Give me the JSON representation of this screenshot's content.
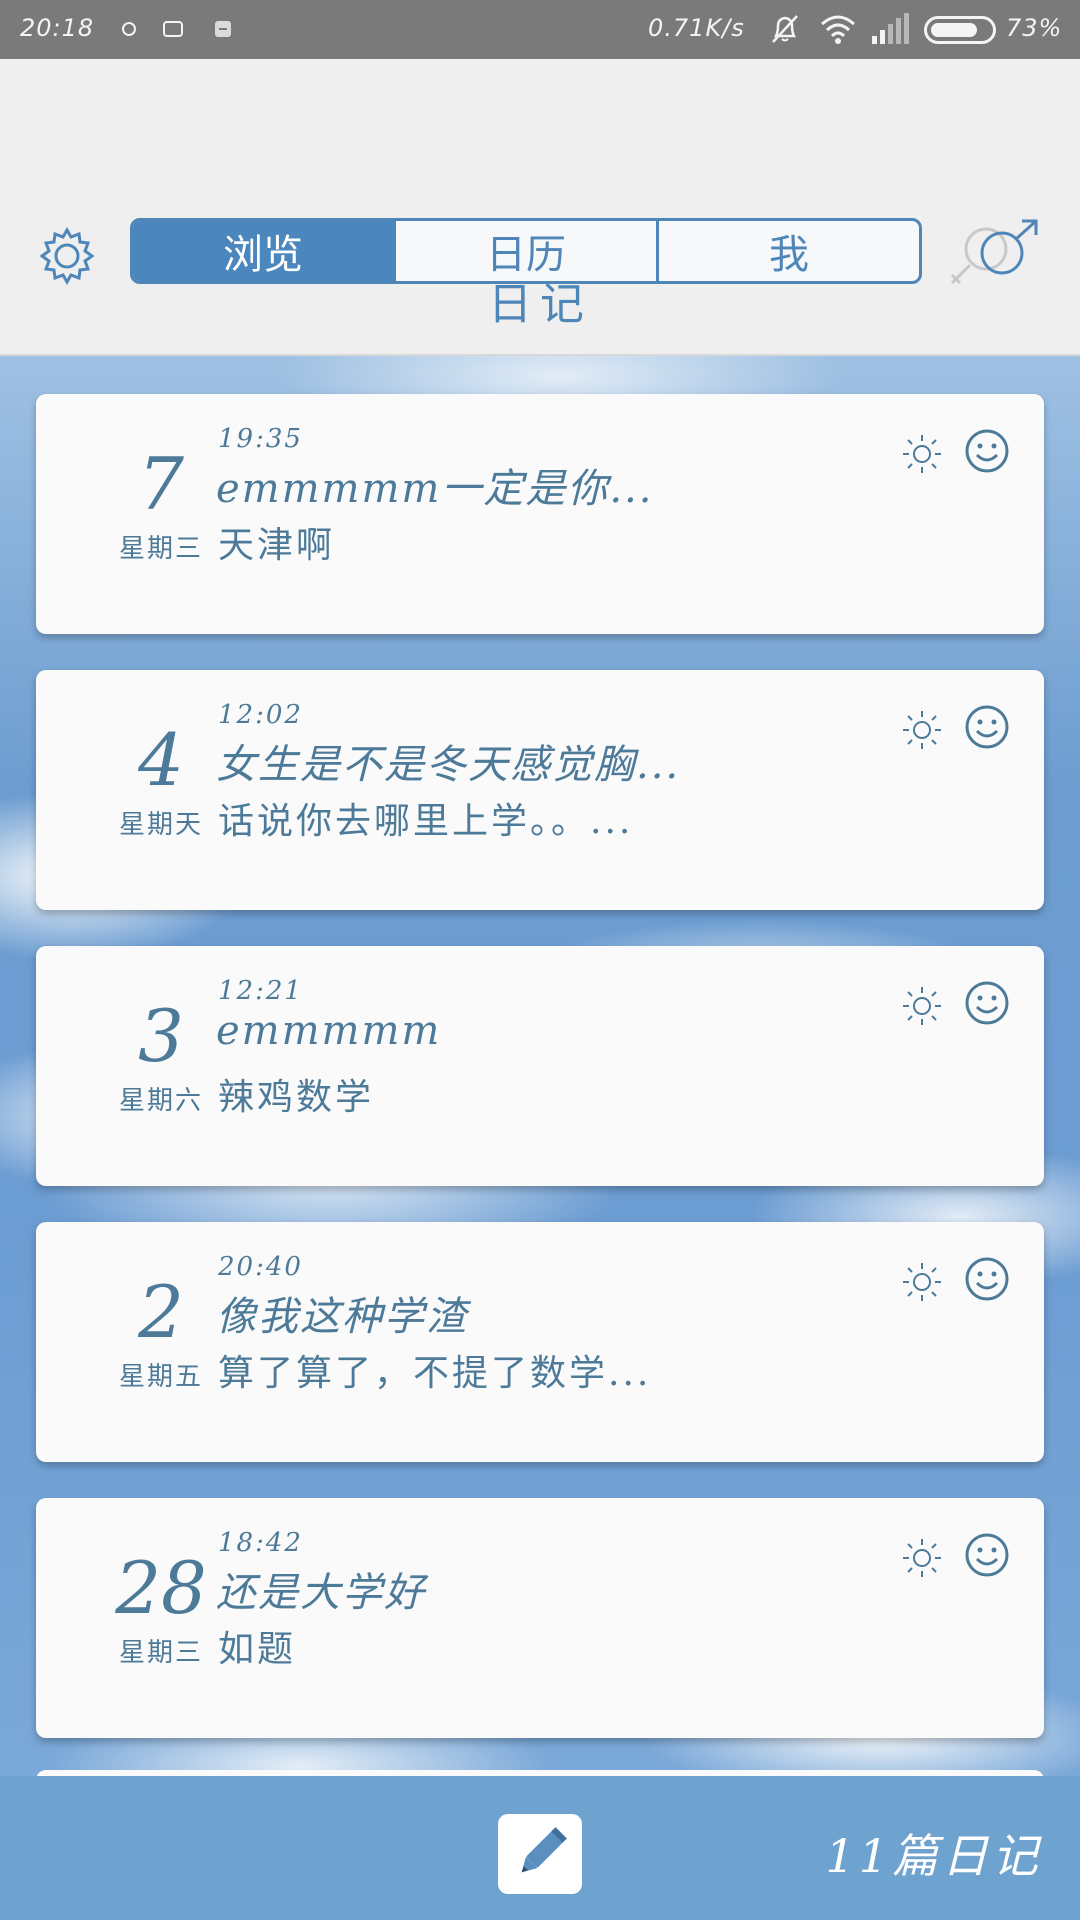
{
  "status_bar": {
    "time": "20:18",
    "net_speed": "0.71K/s",
    "battery_pct": "73%",
    "battery_level": 0.73,
    "icons": [
      "circle-notification-icon",
      "hd-icon",
      "message-icon",
      "mute-icon",
      "wifi-icon",
      "signal-icon",
      "battery-icon"
    ]
  },
  "header": {
    "tabs": [
      {
        "label": "浏览",
        "active": true
      },
      {
        "label": "日历",
        "active": false
      },
      {
        "label": "我",
        "active": false
      }
    ],
    "title": "日记",
    "icons": {
      "settings": "gear-icon",
      "gender": "gender-icon"
    },
    "accent": "#4b86bd"
  },
  "entries": [
    {
      "day": "7",
      "weekday": "星期三",
      "time": "19:35",
      "title": "emmmmm一定是你...",
      "body": "天津啊",
      "weather": "sun-icon",
      "mood": "smile-icon"
    },
    {
      "day": "4",
      "weekday": "星期天",
      "time": "12:02",
      "title": "女生是不是冬天感觉胸...",
      "body": "话说你去哪里上学。。...",
      "weather": "sun-icon",
      "mood": "smile-icon"
    },
    {
      "day": "3",
      "weekday": "星期六",
      "time": "12:21",
      "title": "emmmmm",
      "body": "辣鸡数学",
      "weather": "sun-icon",
      "mood": "smile-icon"
    },
    {
      "day": "2",
      "weekday": "星期五",
      "time": "20:40",
      "title": "像我这种学渣",
      "body": "算了算了，不提了数学...",
      "weather": "sun-icon",
      "mood": "smile-icon"
    },
    {
      "day": "28",
      "weekday": "星期三",
      "time": "18:42",
      "title": "还是大学好",
      "body": "如题",
      "weather": "sun-icon",
      "mood": "smile-icon"
    }
  ],
  "bottom_bar": {
    "count_label": "11篇日记",
    "compose_icon": "pencil-icon",
    "color": "#6ea2cf"
  }
}
